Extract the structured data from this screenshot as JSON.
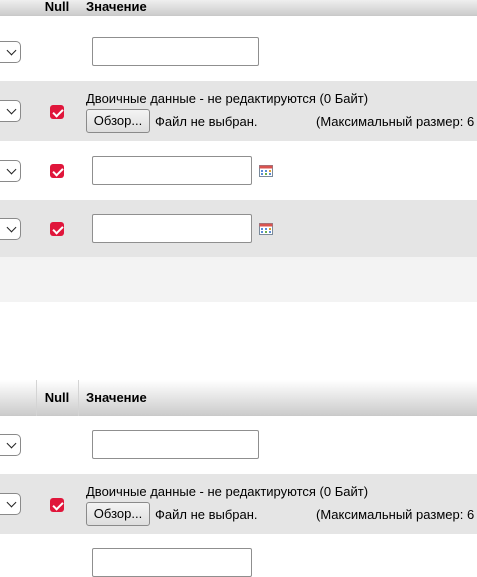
{
  "table1": {
    "header": {
      "null_label": "Null",
      "value_label": "Значение"
    },
    "binary_note": "Двоичные данные - не редактируются (0 Байт)",
    "browse_label": "Обзор...",
    "no_file_label": "Файл не выбран.",
    "max_size_label": "(Максимальный размер: 6"
  },
  "table2": {
    "header": {
      "null_label": "Null",
      "value_label": "Значение"
    },
    "binary_note": "Двоичные данные - не редактируются (0 Байт)",
    "browse_label": "Обзор...",
    "no_file_label": "Файл не выбран.",
    "max_size_label": "(Максимальный размер: 6"
  },
  "colors": {
    "checkbox_checked": "#e0163b",
    "row_alt": "#e5e5e5"
  },
  "icons": [
    "chevron-down-icon",
    "checkmark-icon",
    "calendar-icon"
  ]
}
